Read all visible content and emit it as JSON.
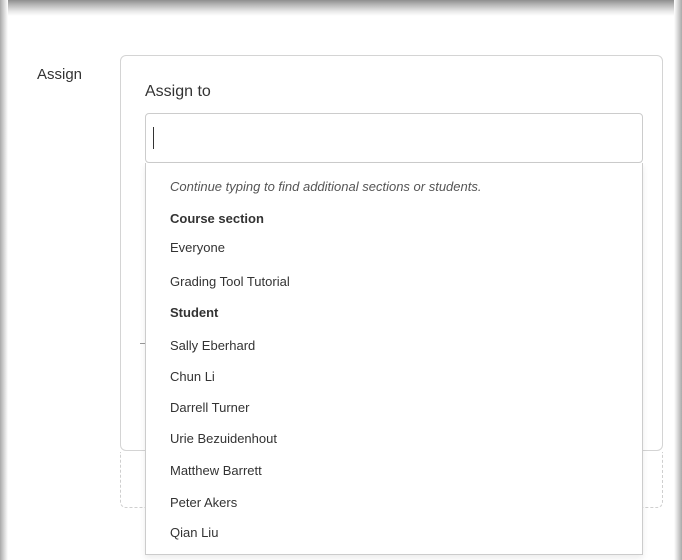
{
  "form": {
    "row_label": "Assign",
    "field_label": "Assign to",
    "input_value": "",
    "input_placeholder": ""
  },
  "dropdown": {
    "hint": "Continue typing to find additional sections or students.",
    "groups": [
      {
        "label": "Course section",
        "items": [
          "Everyone",
          "Grading Tool Tutorial"
        ]
      },
      {
        "label": "Student",
        "items": [
          "Sally Eberhard",
          "Chun Li",
          "Darrell Turner",
          "Urie Bezuidenhout",
          "Matthew Barrett",
          "Peter Akers",
          "Qian Liu"
        ]
      }
    ]
  }
}
